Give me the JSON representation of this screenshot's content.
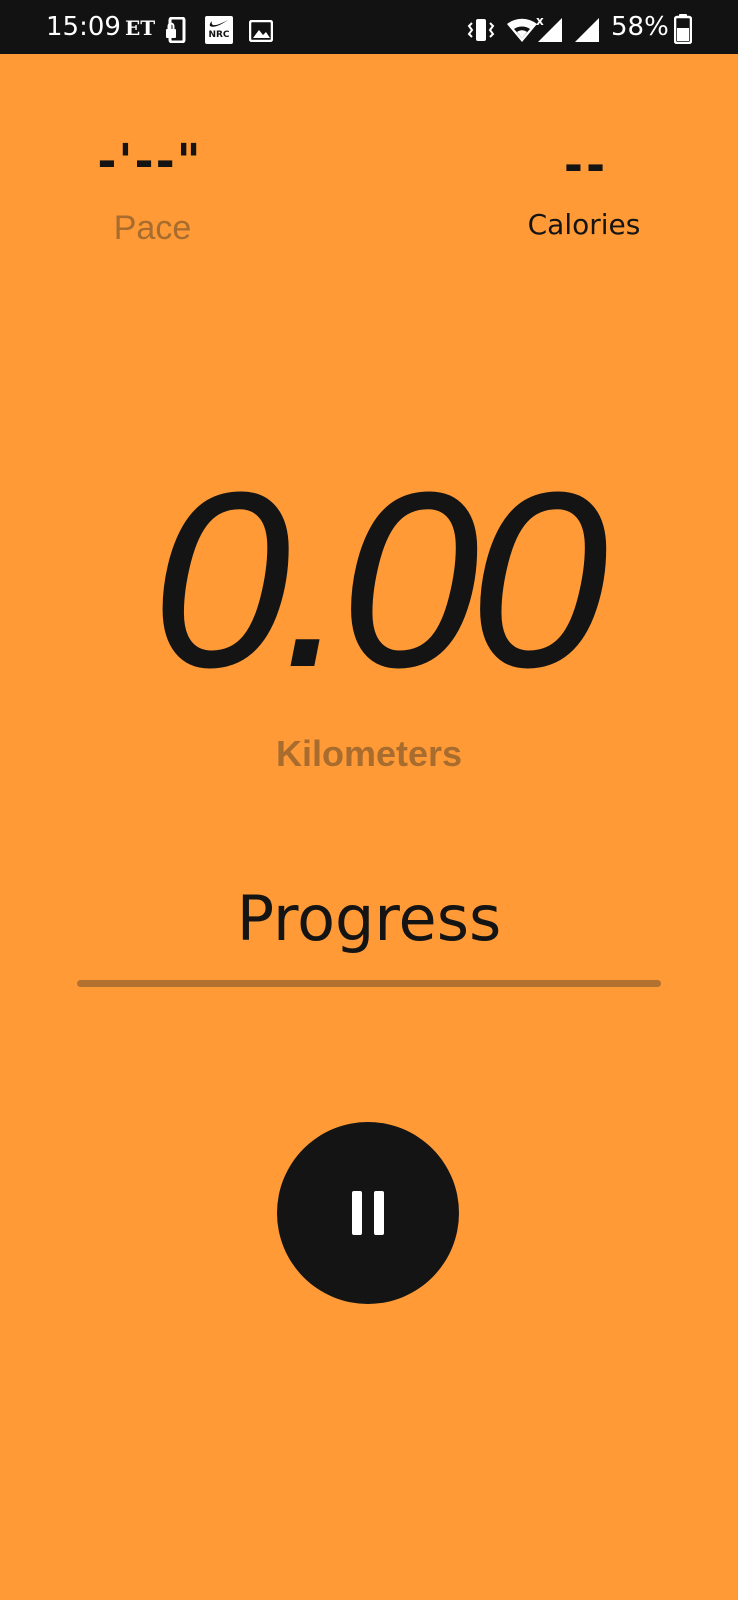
{
  "status_bar": {
    "time": "15:09",
    "carrier_text": "ET",
    "battery_percent": "58%",
    "icons": [
      "lock-phone-icon",
      "nrc-app-icon",
      "gallery-icon",
      "vibrate-icon",
      "wifi-icon",
      "signal-icon",
      "signal-icon",
      "battery-icon"
    ],
    "nrc_label": "NRC"
  },
  "stats": {
    "pace_value": "-'--\"",
    "pace_label": "Pace",
    "calories_value": "--",
    "calories_label": "Calories"
  },
  "distance": {
    "value": "0.00",
    "unit": "Kilometers"
  },
  "progress": {
    "title": "Progress"
  },
  "controls": {
    "pause_icon": "pause-icon"
  },
  "colors": {
    "background": "#FF9A36",
    "text_dark": "#141414",
    "label_muted": "#A76C2E",
    "status_bar": "#121212"
  }
}
